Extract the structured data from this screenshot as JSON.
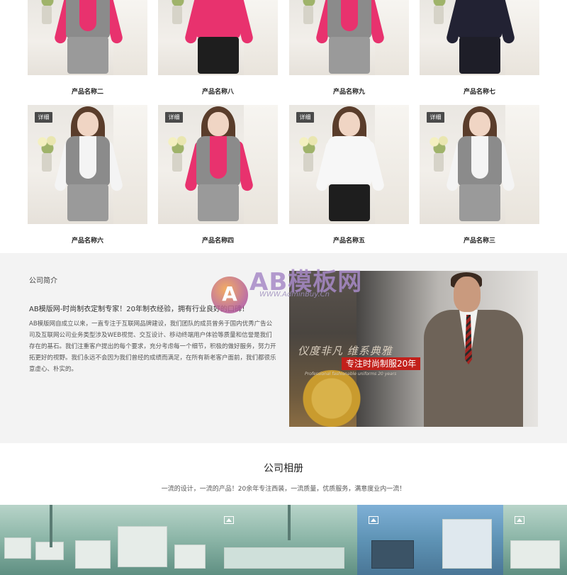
{
  "products": [
    {
      "name": "产品名称二",
      "badge": "",
      "top_color": "#e8326e",
      "vest": "#8b8b8b",
      "skirt": "#9a9a9a"
    },
    {
      "name": "产品名称八",
      "badge": "",
      "top_color": "#e8326e",
      "vest": "#e8326e",
      "skirt": "#1e1e1e"
    },
    {
      "name": "产品名称九",
      "badge": "",
      "top_color": "#e8326e",
      "vest": "#8b8b8b",
      "skirt": "#9a9a9a"
    },
    {
      "name": "产品名称七",
      "badge": "",
      "top_color": "#222233",
      "vest": "#222233",
      "skirt": "#1e1e28"
    },
    {
      "name": "产品名称六",
      "badge": "详细",
      "top_color": "#f4f4f4",
      "vest": "#8b8b8b",
      "skirt": "#9a9a9a"
    },
    {
      "name": "产品名称四",
      "badge": "详细",
      "top_color": "#e8326e",
      "vest": "#8b8b8b",
      "skirt": "#9a9a9a"
    },
    {
      "name": "产品名称五",
      "badge": "详细",
      "top_color": "#f7f7f7",
      "vest": "#f7f7f7",
      "skirt": "#1e1e1e"
    },
    {
      "name": "产品名称三",
      "badge": "详细",
      "top_color": "#f4f4f4",
      "vest": "#8b8b8b",
      "skirt": "#9a9a9a"
    }
  ],
  "intro": {
    "label": "公司简介",
    "headline": "AB模版网-时尚制衣定制专家！20年制衣经验，拥有行业良好的口碑！",
    "body": "AB模版网自成立以来，一直专注于互联网品牌建设，我们团队的成员曾务于国内优秀广告公司及互联网公司业务类型涉及WEB视觉、交互设计、移动终端用户体验等质量和信誉是我们存在的基石。我们注重客户提出的每个要求，充分考虑每一个细节，积极的做好服务，努力开拓更好的视野。我们永远不会因为我们曾经的成绩而满足，在所有新老客户面前，我们都很乐意虚心、朴实的。"
  },
  "banner": {
    "line1": "仪度非凡 维系典雅",
    "line2": "专注时尚制服20年",
    "line3": "Professional fashionable uniforms 20 years"
  },
  "watermark": {
    "logo": "A",
    "text": "AB模板网",
    "url": "WWW.AdminBuy.Cn"
  },
  "album": {
    "title": "公司相册",
    "subtitle": "一流的设计，一流的产品！20余年专注西装，一流质量，优质服务，满意度业内一流！"
  },
  "colors": {
    "section_bg": "#f3f3f3",
    "badge_bg": "#4a4a4a",
    "accent_red": "#c2201b"
  }
}
